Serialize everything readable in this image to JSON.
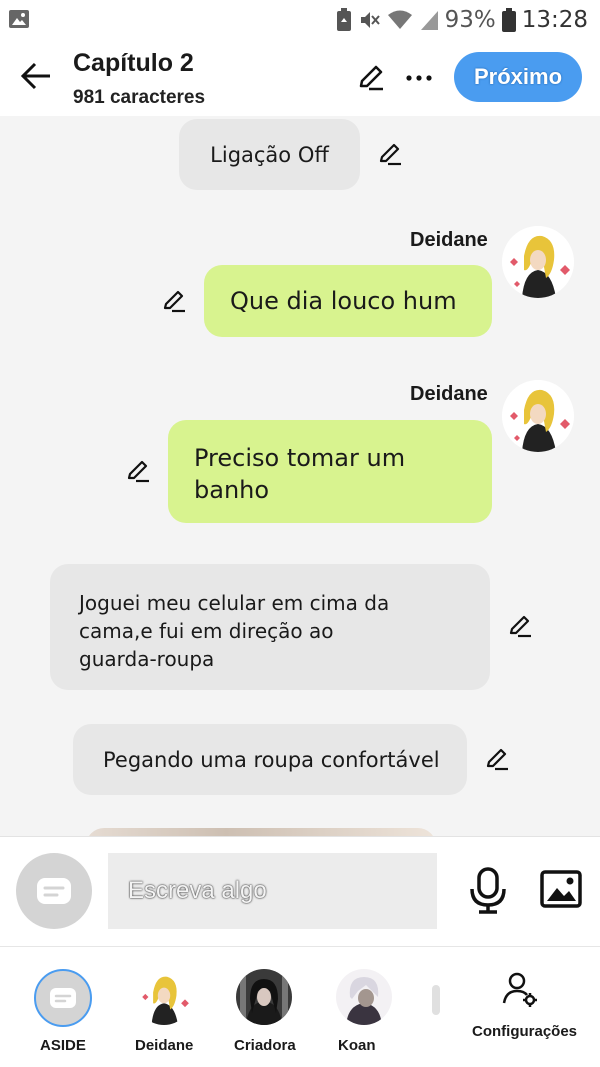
{
  "status_bar": {
    "battery_percent": "93%",
    "time": "13:28"
  },
  "header": {
    "title": "Capítulo 2",
    "subtitle": "981 caracteres",
    "next_label": "Próximo"
  },
  "messages": [
    {
      "type": "aside",
      "text": "Ligação Off"
    },
    {
      "type": "character",
      "author": "Deidane",
      "text": "Que dia louco hum"
    },
    {
      "type": "character",
      "author": "Deidane",
      "text": "Preciso tomar um banho"
    },
    {
      "type": "aside",
      "text": "Joguei meu celular em cima da cama,e fui em direção ao guarda-roupa"
    },
    {
      "type": "aside",
      "text": "Pegando uma roupa confortável"
    }
  ],
  "composer": {
    "placeholder": "Escreva algo"
  },
  "bottom_nav": [
    {
      "label": "ASIDE"
    },
    {
      "label": "Deidane"
    },
    {
      "label": "Criadora"
    },
    {
      "label": "Koan"
    },
    {
      "label": "Configurações"
    }
  ],
  "colors": {
    "accent": "#4a9cf0",
    "character_bubble": "#d8f38f",
    "aside_bubble": "#e7e7e7"
  }
}
